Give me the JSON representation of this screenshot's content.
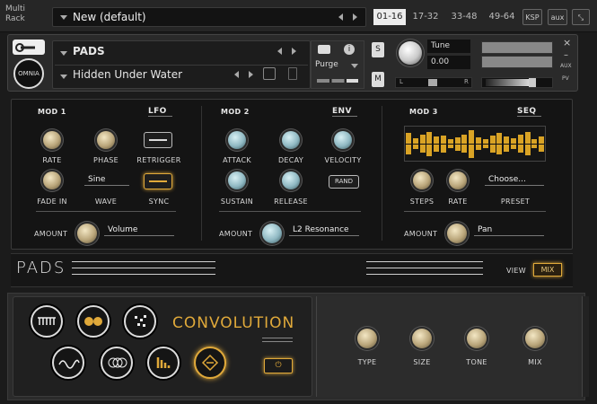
{
  "topbar": {
    "multi_rack": "Multi\nRack",
    "rack_name": "New (default)",
    "tabs": [
      "01-16",
      "17-32",
      "33-48",
      "49-64"
    ],
    "ksp": "KSP",
    "aux": "aux"
  },
  "instrument": {
    "logo": "OMNIA",
    "preset_bank": "PADS",
    "preset_name": "Hidden Under Water",
    "purge": "Purge",
    "solo": "S",
    "mute": "M",
    "tune_label": "Tune",
    "tune_value": "0.00",
    "pan_l": "L",
    "pan_r": "R",
    "aux_label": "AUX",
    "pv_label": "PV"
  },
  "mod1": {
    "title": "MOD 1",
    "type": "LFO",
    "rate": "RATE",
    "phase": "PHASE",
    "retrigger": "RETRIGGER",
    "fade_in": "FADE IN",
    "wave_value": "Sine",
    "wave": "WAVE",
    "sync": "SYNC",
    "amount": "AMOUNT",
    "target": "Volume"
  },
  "mod2": {
    "title": "MOD 2",
    "type": "ENV",
    "attack": "ATTACK",
    "decay": "DECAY",
    "velocity": "VELOCITY",
    "sustain": "SUSTAIN",
    "release": "RELEASE",
    "rand": "RAND",
    "amount": "AMOUNT",
    "target": "L2 Resonance"
  },
  "mod3": {
    "title": "MOD 3",
    "type": "SEQ",
    "steps": "STEPS",
    "rate": "RATE",
    "preset_value": "Choose...",
    "preset": "PRESET",
    "amount": "AMOUNT",
    "target": "Pan",
    "seq_steps": [
      0.7,
      0.35,
      0.6,
      0.8,
      0.5,
      0.55,
      0.3,
      0.45,
      0.6,
      0.9,
      0.4,
      0.3,
      0.55,
      0.7,
      0.5,
      0.35,
      0.6,
      0.75,
      0.3,
      0.5
    ]
  },
  "strip": {
    "name": "PADS",
    "view": "VIEW",
    "mix": "MIX"
  },
  "effect": {
    "name": "CONVOLUTION",
    "type": "TYPE",
    "size": "SIZE",
    "tone": "TONE",
    "mix": "MIX"
  },
  "colors": {
    "accent": "#e0a93a",
    "seq": "#d9a325"
  }
}
